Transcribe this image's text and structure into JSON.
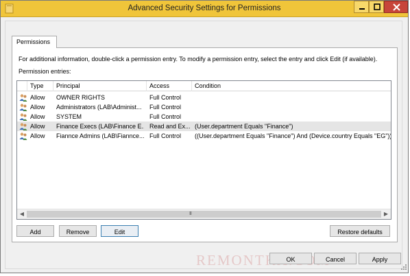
{
  "window": {
    "title": "Advanced Security Settings for Permissions",
    "accent_color": "#f0c53a",
    "close_color": "#c7453a"
  },
  "tabs": [
    {
      "label": "Permissions",
      "selected": true
    }
  ],
  "panel": {
    "info_text": "For additional information, double-click a permission entry. To modify a permission entry, select the entry and click Edit (if available).",
    "entries_label": "Permission entries:"
  },
  "list": {
    "columns": [
      "Type",
      "Principal",
      "Access",
      "Condition"
    ],
    "rows": [
      {
        "icon": "users-icon",
        "type": "Allow",
        "principal": "OWNER RIGHTS",
        "access": "Full Control",
        "condition": "",
        "selected": false
      },
      {
        "icon": "users-icon",
        "type": "Allow",
        "principal": "Administrators (LAB\\Administ...",
        "access": "Full Control",
        "condition": "",
        "selected": false
      },
      {
        "icon": "users-icon",
        "type": "Allow",
        "principal": "SYSTEM",
        "access": "Full Control",
        "condition": "",
        "selected": false
      },
      {
        "icon": "users-icon",
        "type": "Allow",
        "principal": "Finance Execs (LAB\\Finance E...",
        "access": "Read and Ex...",
        "condition": "(User.department Equals \"Finance\")",
        "selected": true
      },
      {
        "icon": "users-icon",
        "type": "Allow",
        "principal": "Fiannce Admins (LAB\\Fiannce...",
        "access": "Full Control",
        "condition": "((User.department Equals \"Finance\") And (Device.country Equals \"EG\"))",
        "selected": false
      }
    ],
    "scrollbar_grip": "III"
  },
  "buttons": {
    "add": "Add",
    "remove": "Remove",
    "edit": "Edit",
    "restore_defaults": "Restore defaults",
    "ok": "OK",
    "cancel": "Cancel",
    "apply": "Apply"
  },
  "watermark": "REMONTKA.COM"
}
